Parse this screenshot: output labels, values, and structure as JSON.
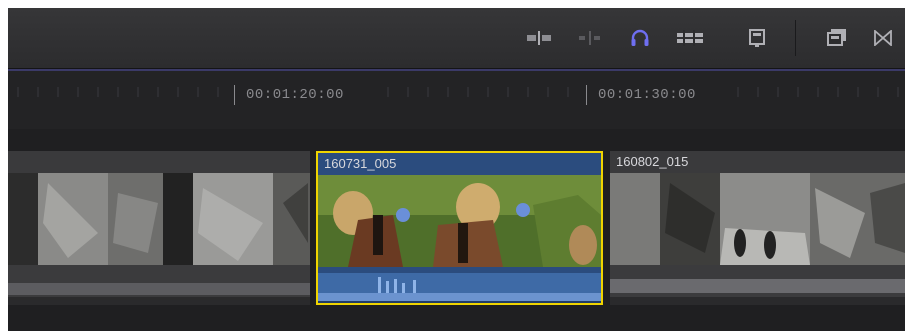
{
  "timeline": {
    "ruler": {
      "timecodes": [
        "00:01:20:00",
        "00:01:30:00"
      ]
    },
    "clips": [
      {
        "name": ""
      },
      {
        "name": "160731_005",
        "selected": true
      },
      {
        "name": "160802_015"
      }
    ]
  },
  "toolbar": {
    "buttons": [
      {
        "icon": "split-clip-icon"
      },
      {
        "icon": "trim-icon"
      },
      {
        "icon": "headphones-icon",
        "active": true
      },
      {
        "icon": "clip-appearance-icon"
      },
      {
        "icon": "inspector-icon"
      },
      {
        "icon": "effects-browser-icon"
      },
      {
        "icon": "transitions-browser-icon"
      }
    ]
  },
  "colors": {
    "accent": "#6e6ef0",
    "selection": "#f0d400",
    "clip_blue": "#2b4c7e",
    "clip_gray": "#3a3a3c"
  }
}
